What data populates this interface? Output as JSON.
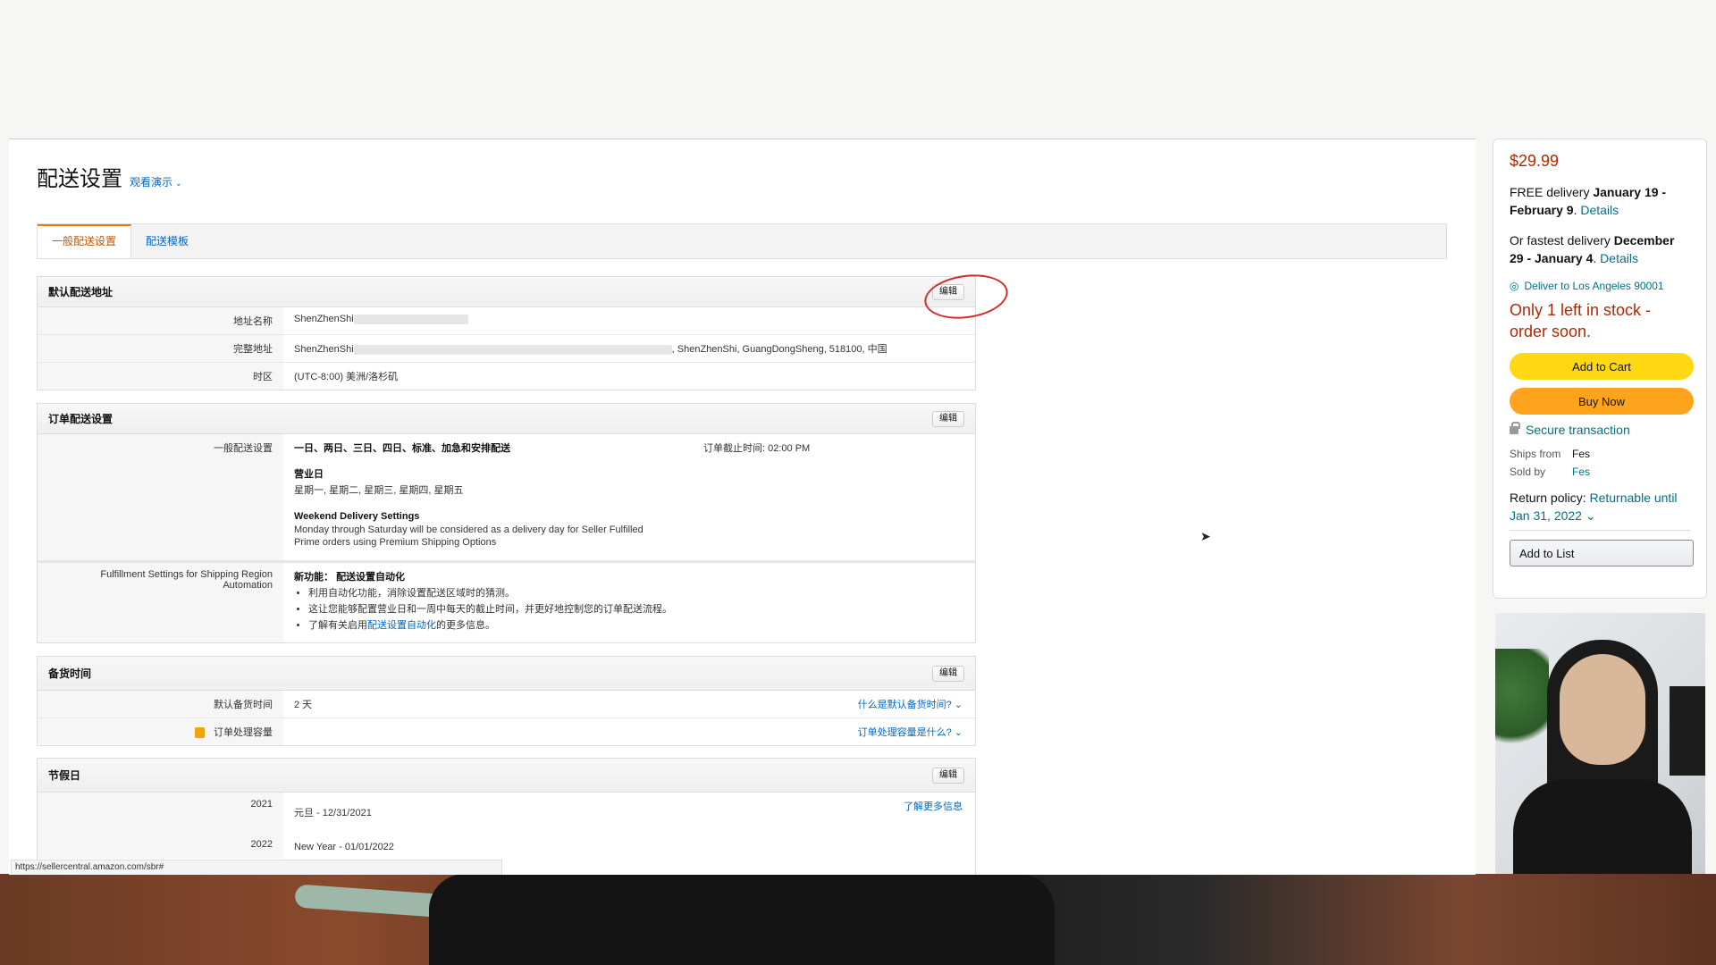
{
  "page": {
    "title": "配送设置",
    "demo_link": "观看演示",
    "tabs": [
      "一般配送设置",
      "配送模板"
    ]
  },
  "sections": {
    "default_address": {
      "title": "默认配送地址",
      "edit": "编辑",
      "rows": [
        {
          "label": "地址名称",
          "value": "ShenZhenShi"
        },
        {
          "label": "完整地址",
          "value": "ShenZhenShi",
          "value_suffix": ", ShenZhenShi, GuangDongSheng, 518100, 中国"
        },
        {
          "label": "时区",
          "value": "(UTC-8:00) 美洲/洛杉矶"
        }
      ]
    },
    "order_shipping": {
      "title": "订单配送设置",
      "edit": "编辑",
      "general_label": "一般配送设置",
      "general_value": "一日、两日、三日、四日、标准、加急和安排配送",
      "cutoff": "订单截止时间: 02:00 PM",
      "business_days_title": "营业日",
      "business_days": "星期一, 星期二, 星期三, 星期四, 星期五",
      "weekend_title": "Weekend Delivery Settings",
      "weekend_text_1": "Monday through Saturday will be considered as a delivery day for Seller Fulfilled",
      "weekend_text_2": "Prime orders using Premium Shipping Options",
      "automation_label_1": "Fulfillment Settings for Shipping Region",
      "automation_label_2": "Automation",
      "new_feature_prefix": "新功能：",
      "new_feature_title": "配送设置自动化",
      "bullets": [
        "利用自动化功能，消除设置配送区域时的猜测。",
        "这让您能够配置营业日和一周中每天的截止时间，并更好地控制您的订单配送流程。"
      ],
      "bullet3_prefix": "了解有关启用",
      "bullet3_link": "配送设置自动化",
      "bullet3_suffix": "的更多信息。"
    },
    "handling_time": {
      "title": "备货时间",
      "edit": "编辑",
      "rows": [
        {
          "label": "默认备货时间",
          "value": "2 天",
          "link": "什么是默认备货时间?"
        },
        {
          "label": "订单处理容量",
          "value": "",
          "link": "订单处理容量是什么?"
        }
      ]
    },
    "holidays": {
      "title": "节假日",
      "edit": "编辑",
      "learn_more": "了解更多信息",
      "rows": [
        {
          "label": "2021",
          "value": "元旦 - 12/31/2021"
        },
        {
          "label": "2022",
          "value": "New Year - 01/01/2022"
        }
      ]
    }
  },
  "status_url": "https://sellercentral.amazon.com/sbr#",
  "buybox": {
    "price": "$29.99",
    "free_delivery_prefix": "FREE delivery ",
    "free_delivery_dates": "January 19 - February 9",
    "details": "Details",
    "fastest_prefix": "Or fastest delivery ",
    "fastest_dates": "December 29 - January 4",
    "deliver_to": "Deliver to Los Angeles 90001",
    "stock": "Only 1 left in stock - order soon.",
    "add_to_cart": "Add to Cart",
    "buy_now": "Buy Now",
    "secure": "Secure transaction",
    "ships_from_label": "Ships from",
    "ships_from": "Fes",
    "sold_by_label": "Sold by",
    "sold_by": "Fes",
    "return_prefix": "Return policy: ",
    "return_link": "Returnable until Jan 31, 2022",
    "add_to_list": "Add to List",
    "accent_price": "#b12704",
    "cart_color": "#ffd814",
    "buy_color": "#ffa41c"
  }
}
